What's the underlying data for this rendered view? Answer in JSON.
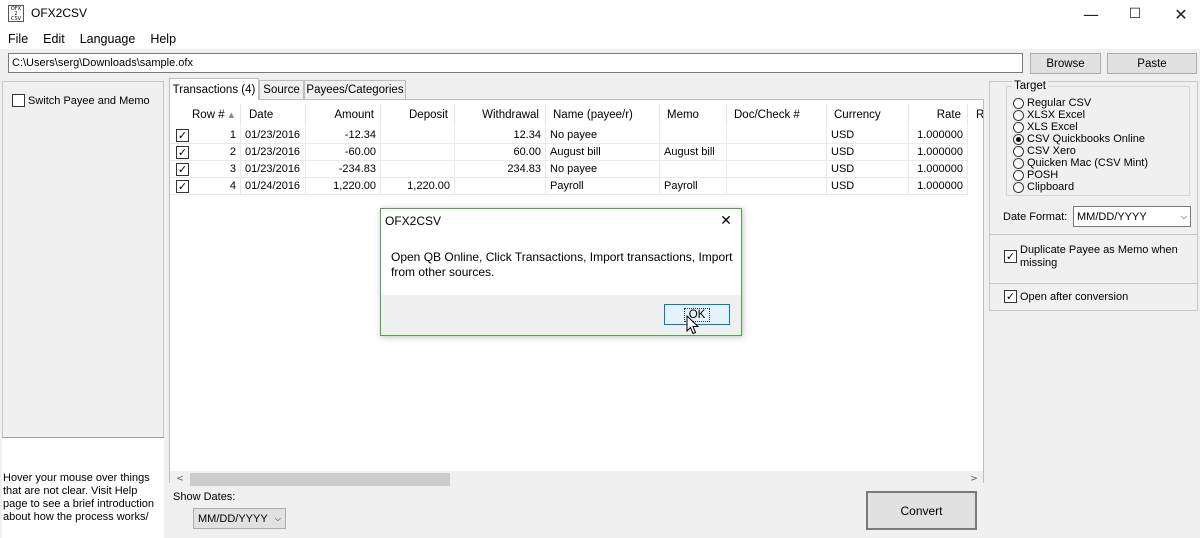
{
  "window": {
    "title": "OFX2CSV",
    "icon_text": "OFX\n2\nCSV",
    "minimize": "—",
    "maximize": "☐",
    "close": "✕"
  },
  "menu": [
    "File",
    "Edit",
    "Language",
    "Help"
  ],
  "toolbar": {
    "path_value": "C:\\Users\\serg\\Downloads\\sample.ofx",
    "browse_label": "Browse",
    "paste_label": "Paste"
  },
  "left_panel": {
    "switch_label": "Switch Payee and Memo",
    "hint": "Hover your mouse over things that are not clear. Visit Help page to see a brief introduction about how the process works/"
  },
  "tabs": [
    "Transactions (4)",
    "Source",
    "Payees/Categories"
  ],
  "grid": {
    "columns": [
      "Row #",
      "Date",
      "Amount",
      "Deposit",
      "Withdrawal",
      "Name (payee/r)",
      "Memo",
      "Doc/Check #",
      "Currency",
      "Rate",
      "R"
    ],
    "sort_glyph": "▲",
    "rows": [
      {
        "row": "1",
        "date": "01/23/2016",
        "amount": "-12.34",
        "deposit": "",
        "withdrawal": "12.34",
        "name": "No payee",
        "memo": "",
        "doc": "",
        "currency": "USD",
        "rate": "1.000000"
      },
      {
        "row": "2",
        "date": "01/23/2016",
        "amount": "-60.00",
        "deposit": "",
        "withdrawal": "60.00",
        "name": "August bill",
        "memo": "August bill",
        "doc": "",
        "currency": "USD",
        "rate": "1.000000"
      },
      {
        "row": "3",
        "date": "01/23/2016",
        "amount": "-234.83",
        "deposit": "",
        "withdrawal": "234.83",
        "name": "No payee",
        "memo": "",
        "doc": "",
        "currency": "USD",
        "rate": "1.000000"
      },
      {
        "row": "4",
        "date": "01/24/2016",
        "amount": "1,220.00",
        "deposit": "1,220.00",
        "withdrawal": "",
        "name": "Payroll",
        "memo": "Payroll",
        "doc": "",
        "currency": "USD",
        "rate": "1.000000"
      }
    ]
  },
  "bottom": {
    "show_dates_label": "Show Dates:",
    "show_dates_value": "MM/DD/YYYY",
    "convert_label": "Convert"
  },
  "target": {
    "legend": "Target",
    "options": [
      "Regular CSV",
      "XLSX Excel",
      "XLS Excel",
      "CSV Quickbooks Online",
      "CSV Xero",
      "Quicken Mac (CSV Mint)",
      "POSH",
      "Clipboard"
    ],
    "selected": "CSV Quickbooks Online",
    "date_format_label": "Date Format:",
    "date_format_value": "MM/DD/YYYY",
    "duplicate_payee_label": "Duplicate Payee as Memo when missing",
    "open_after_label": "Open after conversion"
  },
  "dialog": {
    "title": "OFX2CSV",
    "message": "Open QB Online, Click Transactions, Import transactions, Import from other sources.",
    "ok_label": "OK"
  }
}
